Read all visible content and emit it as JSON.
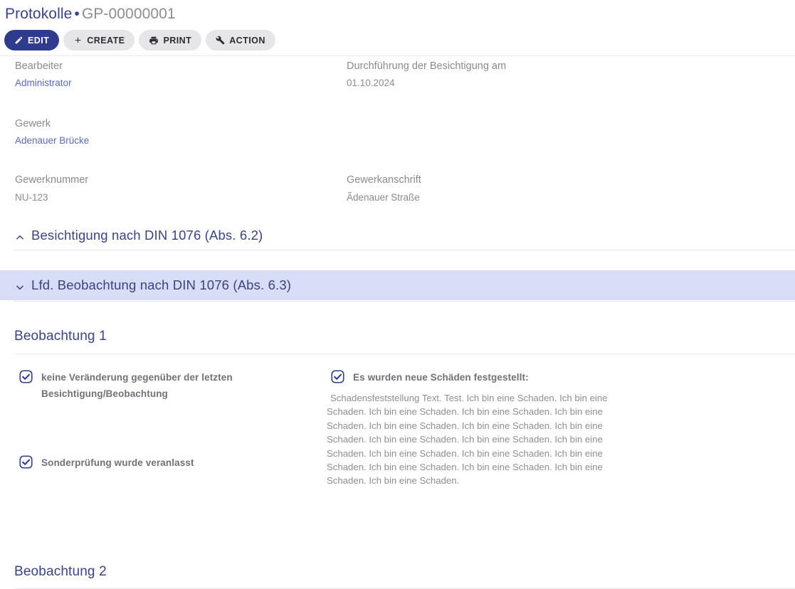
{
  "header": {
    "title_main": "Protokolle",
    "separator": "•",
    "title_sub": "GP-00000001"
  },
  "toolbar": {
    "buttons": [
      {
        "label": "EDIT",
        "icon": "pencil-icon",
        "style": "primary"
      },
      {
        "label": "CREATE",
        "icon": "plus-icon",
        "style": "plain"
      },
      {
        "label": "PRINT",
        "icon": "printer-icon",
        "style": "plain"
      },
      {
        "label": "ACTION",
        "icon": "wrench-icon",
        "style": "plain"
      }
    ]
  },
  "fields": [
    {
      "label": "Bearbeiter",
      "value": "Administrator",
      "kind": "link"
    },
    {
      "label": "Durchführung der Besichtigung am",
      "value": "01.10.2024",
      "kind": "text"
    },
    {
      "label": "Gewerk",
      "value": "Adenauer Brücke",
      "kind": "link"
    },
    {
      "label": "Gewerknummer",
      "value": "NU-123",
      "kind": "text"
    },
    {
      "label": "Gewerkanschrift",
      "value": "Ãdenauer Straße",
      "kind": "text"
    }
  ],
  "accordions": [
    {
      "label": "Besichtigung nach DIN 1076 (Abs. 6.2)",
      "chevron": "chevron-up-icon",
      "expanded": false,
      "highlighted": false
    },
    {
      "label": "Lfd. Beobachtung nach DIN 1076 (Abs. 6.3)",
      "chevron": "chevron-down-icon",
      "expanded": true,
      "highlighted": true
    }
  ],
  "observations": [
    {
      "title": "Beobachtung 1"
    },
    {
      "title": "Beobachtung 2"
    }
  ],
  "checkboxes": [
    {
      "label": "keine Veränderung gegenüber der letzten Besichtigung/Beobachtung",
      "checked": true
    },
    {
      "label": "Sonderprüfung wurde veranlasst",
      "checked": true
    },
    {
      "label": "Es wurden neue Schäden festgestellt:",
      "checked": true
    }
  ],
  "damage_text": " Schadensfeststellung Text. Test. Ich bin eine Schaden.  Ich bin eine Schaden.  Ich bin eine Schaden.  Ich bin eine Schaden.  Ich bin eine Schaden.  Ich bin eine Schaden.  Ich bin eine Schaden.  Ich bin eine Schaden.  Ich bin eine Schaden.  Ich bin eine Schaden.  Ich bin eine Schaden.  Ich bin eine Schaden.  Ich bin eine Schaden.  Ich bin eine Schaden.  Ich bin eine Schaden.  Ich bin eine Schaden.  Ich bin eine Schaden.  Ich bin eine Schaden.",
  "colors": {
    "primary_navy": "#2f3c8e",
    "title_navy": "#3a4480",
    "link_blue": "#5b6ab4",
    "muted_gray": "#8a8a90",
    "highlight_lavender": "#d7dcf7",
    "button_gray": "#e6e6e8"
  }
}
